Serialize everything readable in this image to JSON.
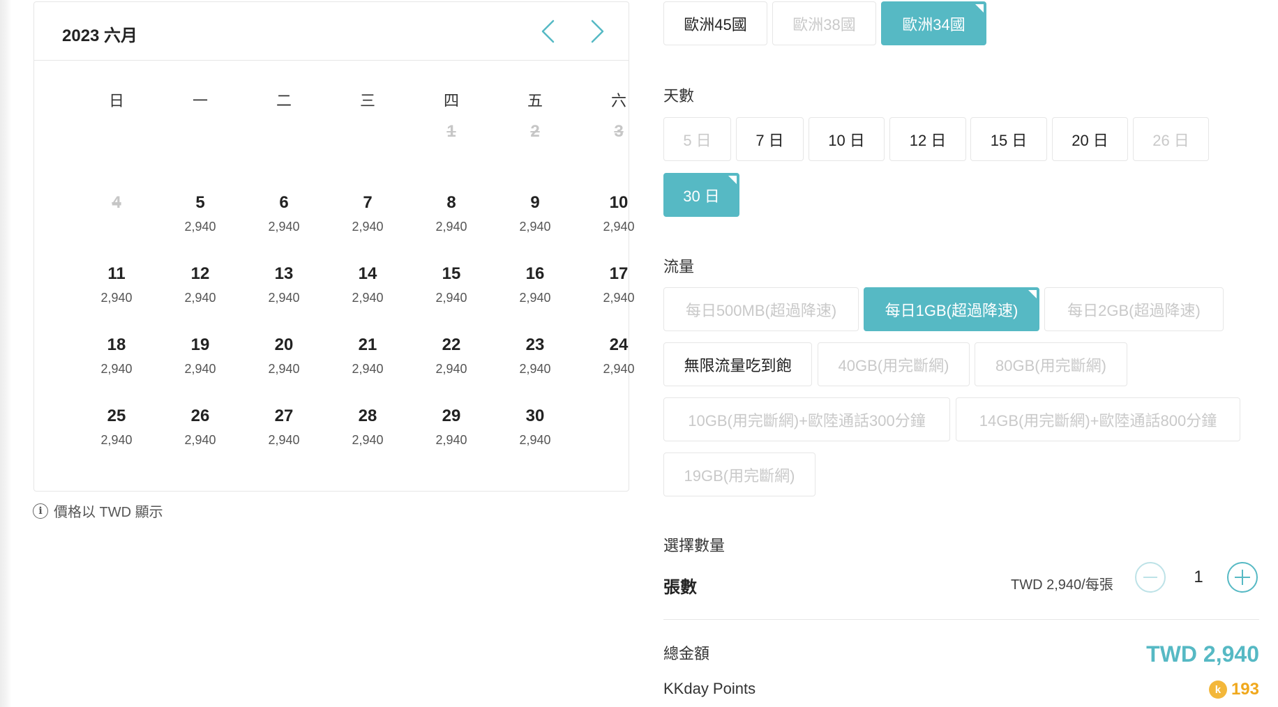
{
  "calendar": {
    "title": "2023 六月",
    "weekdays": [
      "日",
      "一",
      "二",
      "三",
      "四",
      "五",
      "六"
    ],
    "days": [
      {
        "n": "1",
        "price": "",
        "disabled": true
      },
      {
        "n": "2",
        "price": "",
        "disabled": true
      },
      {
        "n": "3",
        "price": "",
        "disabled": true
      },
      {
        "n": "4",
        "price": "",
        "disabled": true
      },
      {
        "n": "5",
        "price": "2,940"
      },
      {
        "n": "6",
        "price": "2,940"
      },
      {
        "n": "7",
        "price": "2,940"
      },
      {
        "n": "8",
        "price": "2,940"
      },
      {
        "n": "9",
        "price": "2,940"
      },
      {
        "n": "10",
        "price": "2,940"
      },
      {
        "n": "11",
        "price": "2,940"
      },
      {
        "n": "12",
        "price": "2,940"
      },
      {
        "n": "13",
        "price": "2,940"
      },
      {
        "n": "14",
        "price": "2,940"
      },
      {
        "n": "15",
        "price": "2,940"
      },
      {
        "n": "16",
        "price": "2,940"
      },
      {
        "n": "17",
        "price": "2,940"
      },
      {
        "n": "18",
        "price": "2,940"
      },
      {
        "n": "19",
        "price": "2,940"
      },
      {
        "n": "20",
        "price": "2,940"
      },
      {
        "n": "21",
        "price": "2,940"
      },
      {
        "n": "22",
        "price": "2,940"
      },
      {
        "n": "23",
        "price": "2,940"
      },
      {
        "n": "24",
        "price": "2,940"
      },
      {
        "n": "25",
        "price": "2,940"
      },
      {
        "n": "26",
        "price": "2,940"
      },
      {
        "n": "27",
        "price": "2,940"
      },
      {
        "n": "28",
        "price": "2,940"
      },
      {
        "n": "29",
        "price": "2,940"
      },
      {
        "n": "30",
        "price": "2,940"
      }
    ],
    "note": "價格以 TWD 顯示"
  },
  "regions": {
    "options": [
      "歐洲45國",
      "歐洲38國",
      "歐洲34國"
    ]
  },
  "days_section": {
    "label": "天數",
    "options": [
      "5 日",
      "7 日",
      "10 日",
      "12 日",
      "15 日",
      "20 日",
      "26 日",
      "30 日"
    ]
  },
  "data_section": {
    "label": "流量",
    "options": [
      "每日500MB(超過降速)",
      "每日1GB(超過降速)",
      "每日2GB(超過降速)",
      "無限流量吃到飽",
      "40GB(用完斷網)",
      "80GB(用完斷網)",
      "10GB(用完斷網)+歐陸通話300分鐘",
      "14GB(用完斷網)+歐陸通話800分鐘",
      "19GB(用完斷網)"
    ]
  },
  "quantity": {
    "label": "選擇數量",
    "item_title": "張數",
    "unit_price": "TWD 2,940/每張",
    "value": "1"
  },
  "total": {
    "label": "總金額",
    "value": "TWD 2,940"
  },
  "points": {
    "label": "KKday Points",
    "coin_letter": "k",
    "value": "193"
  },
  "colors": {
    "accent": "#56b9c4",
    "points": "#f0a81c"
  }
}
